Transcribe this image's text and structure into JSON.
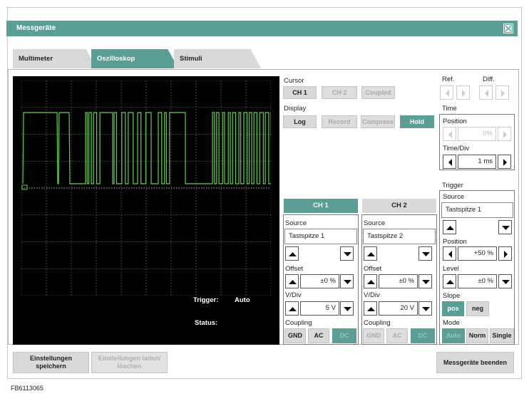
{
  "window": {
    "title": "Messgeräte"
  },
  "tabs": [
    {
      "label": "Multimeter",
      "active": false
    },
    {
      "label": "Oszilloskop",
      "active": true
    },
    {
      "label": "Stimuli",
      "active": false
    }
  ],
  "screen": {
    "trigger_label": "Trigger:",
    "trigger_value": "Auto",
    "status_label": "Status:",
    "status_value": "",
    "trace_color": "#66cc55"
  },
  "cursor": {
    "label": "Cursor",
    "buttons": [
      "CH 1",
      "CH 2",
      "Coupled"
    ]
  },
  "display": {
    "label": "Display",
    "buttons": [
      "Log",
      "Record",
      "Compress",
      "Hold"
    ]
  },
  "ref": {
    "label": "Ref."
  },
  "diff": {
    "label": "Diff."
  },
  "time": {
    "label": "Time",
    "position_label": "Position",
    "position_value": "0%",
    "timediv_label": "Time/Div",
    "timediv_value": "1 ms"
  },
  "ch1": {
    "header": "CH 1",
    "source_label": "Source",
    "source_value": "Tastspitze 1",
    "offset_label": "Offset",
    "offset_value": "±0 %",
    "vdiv_label": "V/Div",
    "vdiv_value": "5 V",
    "coupling_label": "Coupling",
    "coupling_buttons": [
      "GND",
      "AC",
      "DC"
    ]
  },
  "ch2": {
    "header": "CH 2",
    "source_label": "Source",
    "source_value": "Tastspitze 2",
    "offset_label": "Offset",
    "offset_value": "±0 %",
    "vdiv_label": "V/Div",
    "vdiv_value": "20 V",
    "coupling_label": "Coupling",
    "coupling_buttons": [
      "GND",
      "AC",
      "DC"
    ]
  },
  "trigger": {
    "label": "Trigger",
    "source_label": "Source",
    "source_value": "Tastspitze 1",
    "position_label": "Position",
    "position_value": "+50 %",
    "level_label": "Level",
    "level_value": "±0 %",
    "slope_label": "Slope",
    "slope_buttons": [
      "pos",
      "neg"
    ],
    "mode_label": "Mode",
    "mode_buttons": [
      "Auto",
      "Norm",
      "Single"
    ]
  },
  "footer": {
    "save_label": "Einstellungen speichern",
    "load_label": "Einstellungen laden/ löschen",
    "exit_label": "Messgeräte beenden"
  },
  "caption": "FB6113065",
  "colors": {
    "accent": "#5b9e95",
    "button": "#d9d9d9",
    "screen": "#000000"
  }
}
